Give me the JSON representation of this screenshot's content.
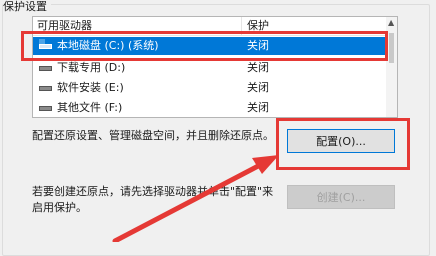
{
  "group": {
    "title": "保护设置"
  },
  "drive_list": {
    "columns": [
      "可用驱动器",
      "保护"
    ],
    "rows": [
      {
        "name": "本地磁盘 (C:) (系统)",
        "protection": "关闭",
        "selected": true,
        "icon": "system-drive-icon"
      },
      {
        "name": "下载专用 (D:)",
        "protection": "关闭",
        "selected": false,
        "icon": "drive-icon"
      },
      {
        "name": "软件安装 (E:)",
        "protection": "关闭",
        "selected": false,
        "icon": "drive-icon"
      },
      {
        "name": "其他文件 (F:)",
        "protection": "关闭",
        "selected": false,
        "icon": "drive-icon"
      }
    ]
  },
  "configure": {
    "description": "配置还原设置、管理磁盘空间，并且删除还原点。",
    "button_label": "配置(O)..."
  },
  "create": {
    "description_line1": "若要创建还原点，请先选择驱动器并单击\"配置\"来",
    "description_line2": "启用保护。",
    "button_label": "创建(C)..."
  },
  "colors": {
    "selection": "#0078d7",
    "annotation_red": "#e53935"
  }
}
